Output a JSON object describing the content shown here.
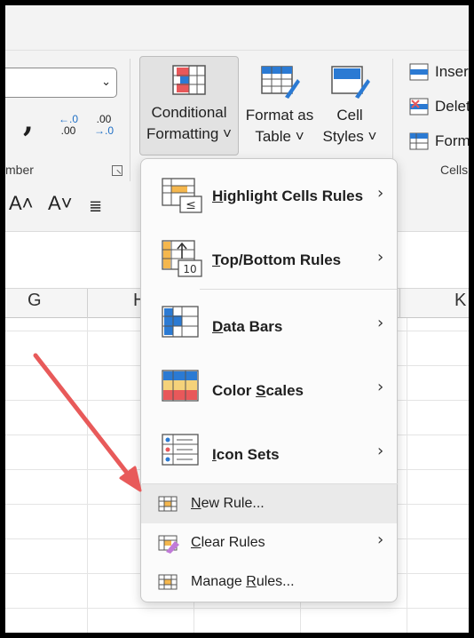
{
  "ribbon": {
    "number_group_label": "mber",
    "cells_group_label": "Cells",
    "comma_symbol": ",",
    "increase_decimal": {
      "top": "←.0",
      "bottom": ".00"
    },
    "decrease_decimal": {
      "top": ".00",
      "bottom": "→.0"
    },
    "conditional_formatting": {
      "line1": "Conditional",
      "line2": "Formatting ˅"
    },
    "format_as_table": {
      "line1": "Format as",
      "line2": "Table ˅"
    },
    "cell_styles": {
      "line1": "Cell",
      "line2": "Styles ˅"
    },
    "insert_label": "Inser",
    "delete_label": "Delet",
    "format_label": "Form",
    "font_increase": "A˄",
    "font_decrease": "A˅",
    "font_more": "≣"
  },
  "sheet": {
    "columns": [
      "G",
      "H",
      "K"
    ]
  },
  "menu": {
    "items": [
      {
        "pre": "",
        "accel": "H",
        "post": "ighlight Cells Rules",
        "submenu": "›"
      },
      {
        "pre": "",
        "accel": "T",
        "post": "op/Bottom Rules",
        "submenu": "›"
      },
      {
        "pre": "",
        "accel": "D",
        "post": "ata Bars",
        "submenu": "›"
      },
      {
        "pre": "Color ",
        "accel": "S",
        "post": "cales",
        "submenu": "›"
      },
      {
        "pre": "",
        "accel": "I",
        "post": "con Sets",
        "submenu": "›"
      },
      {
        "pre": "",
        "accel": "N",
        "post": "ew Rule...",
        "submenu": ""
      },
      {
        "pre": "",
        "accel": "C",
        "post": "lear Rules",
        "submenu": "›"
      },
      {
        "pre": "Manage ",
        "accel": "R",
        "post": "ules...",
        "submenu": ""
      }
    ],
    "top_bottom_icon_number": "10",
    "highlight_icon_symbol": "≤"
  },
  "colors": {
    "accent_red": "#e8585a",
    "arrow": "#e85a5a",
    "icon_blue": "#2b7ad3",
    "icon_orange": "#f5b74d"
  }
}
